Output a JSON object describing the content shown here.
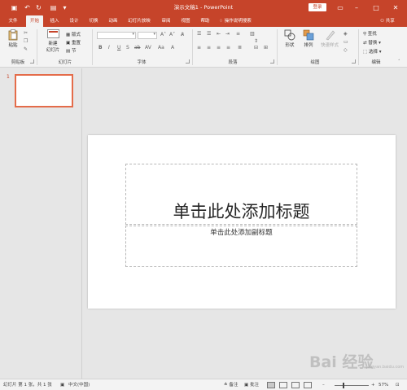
{
  "titlebar": {
    "doc_title": "演示文稿1  -  PowerPoint",
    "login_label": "登录",
    "icons": [
      "save-icon",
      "undo-icon",
      "redo-icon",
      "present-icon",
      "customize-qat-icon"
    ]
  },
  "tabs": [
    "文件",
    "开始",
    "插入",
    "设计",
    "切换",
    "动画",
    "幻灯片放映",
    "审阅",
    "视图",
    "帮助"
  ],
  "active_tab": "开始",
  "tell_me": "操作说明搜索",
  "share_label": "共享",
  "ribbon": {
    "groups": {
      "clipboard": "剪贴板",
      "slides": "幻灯片",
      "font": "字体",
      "paragraph": "段落",
      "drawing": "绘图",
      "editing": "编辑"
    },
    "paste": "粘贴",
    "new_slide_line1": "新建",
    "new_slide_line2": "幻灯片",
    "layout": "版式",
    "reset": "重置",
    "section": "节",
    "shapes": "形状",
    "arrange": "排列",
    "quick_styles": "快速样式",
    "find": "查找",
    "replace": "替换",
    "select": "选择"
  },
  "thumbnails": {
    "slide_number": "1"
  },
  "slide": {
    "title_placeholder": "单击此处添加标题",
    "subtitle_placeholder": "单击此处添加副标题"
  },
  "statusbar": {
    "slide_info": "幻灯片 第 1 张，共 1 张",
    "language": "中文(中国)",
    "notes": "备注",
    "comments": "批注",
    "zoom": "57%"
  },
  "watermark": {
    "brand": "Bai 经验",
    "url": "jingyan.baidu.com"
  },
  "colors": {
    "accent": "#c6442a",
    "thumb_border": "#e46c4a"
  }
}
